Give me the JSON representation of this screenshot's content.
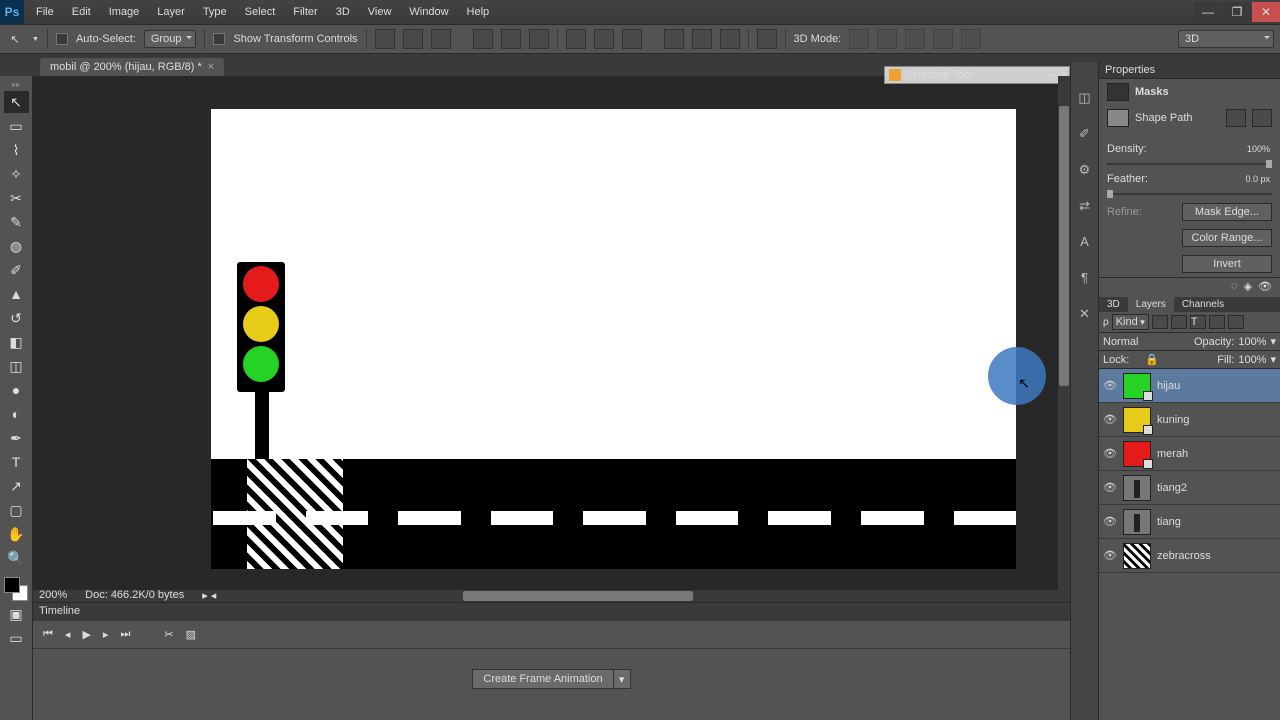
{
  "menu": [
    "File",
    "Edit",
    "Image",
    "Layer",
    "Type",
    "Select",
    "Filter",
    "3D",
    "View",
    "Window",
    "Help"
  ],
  "options": {
    "autoSelect": "Auto-Select:",
    "group": "Group",
    "showTransform": "Show Transform Controls",
    "mode3d": "3D Mode:",
    "viewSel": "3D"
  },
  "docTab": "mobil @ 200% (hijau, RGB/8) *",
  "selectiveTool": "Selective Tool",
  "status": {
    "zoom": "200%",
    "doc": "Doc: 466.2K/0 bytes"
  },
  "timeline": {
    "title": "Timeline",
    "create": "Create Frame Animation"
  },
  "properties": {
    "title": "Properties",
    "masks": "Masks",
    "shapePath": "Shape Path",
    "density": "Density:",
    "densityV": "100%",
    "feather": "Feather:",
    "featherV": "0.0 px",
    "refine": "Refine:",
    "maskEdge": "Mask Edge...",
    "colorRange": "Color Range...",
    "invert": "Invert"
  },
  "layersPanel": {
    "tabs": [
      "3D",
      "Layers",
      "Channels"
    ],
    "kind": "Kind",
    "blend": "Normal",
    "opacityL": "Opacity:",
    "opacityV": "100%",
    "lockL": "Lock:",
    "fillL": "Fill:",
    "fillV": "100%"
  },
  "layers": [
    {
      "name": "hijau",
      "color": "#24d324",
      "sel": true,
      "mask": true
    },
    {
      "name": "kuning",
      "color": "#e6cc18",
      "sel": false,
      "mask": true
    },
    {
      "name": "merah",
      "color": "#e51a1a",
      "sel": false,
      "mask": true
    },
    {
      "name": "tiang2",
      "color": "",
      "sel": false,
      "mask": false
    },
    {
      "name": "tiang",
      "color": "",
      "sel": false,
      "mask": false
    },
    {
      "name": "zebracross",
      "color": "",
      "sel": false,
      "mask": false,
      "pattern": true
    }
  ]
}
